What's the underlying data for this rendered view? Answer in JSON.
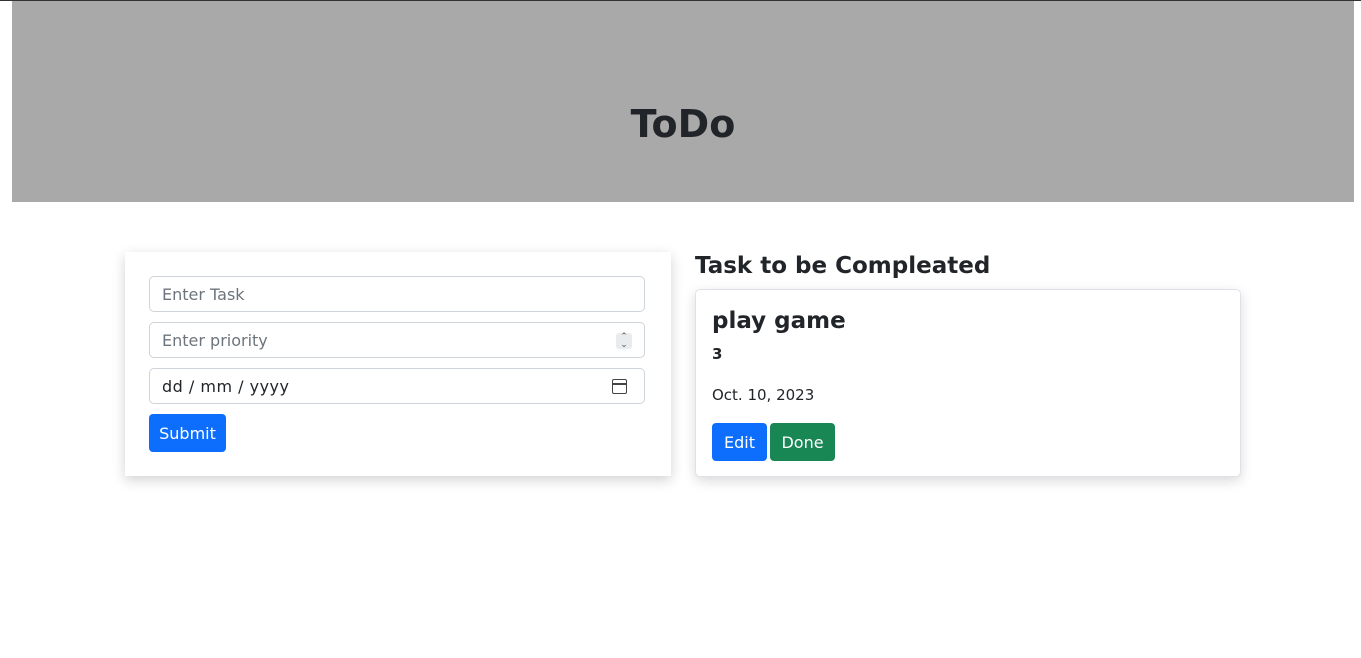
{
  "header": {
    "title": "ToDo"
  },
  "form": {
    "task_placeholder": "Enter Task",
    "priority_placeholder": "Enter priority",
    "date_placeholder": "dd / mm / yyyy",
    "submit_label": "Submit"
  },
  "tasks_section": {
    "title": "Task to be Compleated",
    "tasks": [
      {
        "name": "play game",
        "priority": "3",
        "date": "Oct. 10, 2023",
        "edit_label": "Edit",
        "done_label": "Done"
      }
    ]
  },
  "colors": {
    "header_bg": "#a9a9a9",
    "primary": "#0d6efd",
    "success": "#198754"
  }
}
